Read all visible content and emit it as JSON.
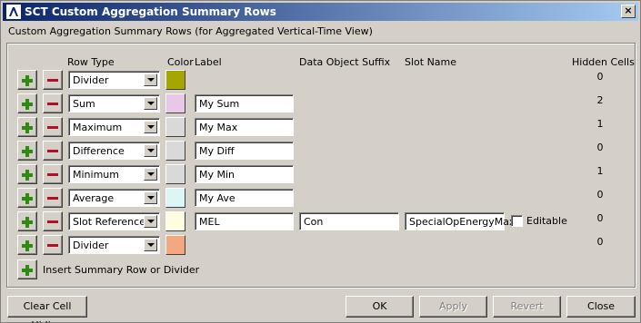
{
  "window": {
    "title": "SCT Custom Aggregation Summary Rows",
    "close_glyph": "×"
  },
  "subtitle": "Custom Aggregation Summary Rows (for Aggregated Vertical-Time View)",
  "headers": {
    "row_type": "Row Type",
    "color": "Color",
    "label": "Label",
    "suffix": "Data Object Suffix",
    "slot": "Slot Name",
    "hidden": "Hidden Cells"
  },
  "rows": [
    {
      "type": "Divider",
      "color": "#a6a600",
      "label": null,
      "hidden": "0"
    },
    {
      "type": "Sum",
      "color": "#e8c8e8",
      "label": "My Sum",
      "hidden": "2"
    },
    {
      "type": "Maximum",
      "color": "#d9d9d9",
      "label": "My Max",
      "hidden": "1"
    },
    {
      "type": "Difference",
      "color": "#d9d9d9",
      "label": "My Diff",
      "hidden": "0"
    },
    {
      "type": "Minimum",
      "color": "#d9d9d9",
      "label": "My Min",
      "hidden": "1"
    },
    {
      "type": "Average",
      "color": "#dcf6f6",
      "label": "My Ave",
      "hidden": "0"
    },
    {
      "type": "Slot Reference",
      "color": "#fffce0",
      "label": "MEL",
      "suffix": "Con",
      "slot": "SpecialOpEnergyMax",
      "editable_label": "Editable",
      "editable": false,
      "hidden": "0"
    },
    {
      "type": "Divider",
      "color": "#f4a880",
      "label": null,
      "hidden": "0"
    }
  ],
  "insert_label": "Insert Summary Row or Divider",
  "buttons": {
    "clear": "Clear Cell Hiding",
    "ok": "OK",
    "apply": "Apply",
    "revert": "Revert",
    "close": "Close"
  },
  "icons": {
    "app": "app-logo-icon",
    "add": "plus-icon",
    "remove": "minus-icon",
    "dropdown": "chevron-down-icon"
  }
}
